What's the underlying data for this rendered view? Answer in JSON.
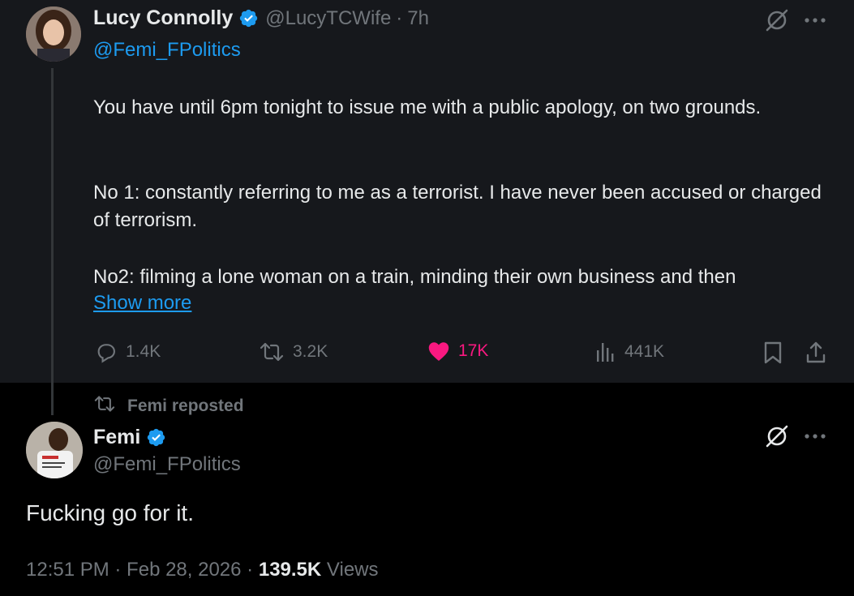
{
  "colors": {
    "background": "#000000",
    "quoted_background": "#16181c",
    "text_primary": "#e7e9ea",
    "text_secondary": "#71767b",
    "link": "#1d9bf0",
    "like": "#f91880",
    "verified": "#1d9bf0"
  },
  "quoted_tweet": {
    "author_name": "Lucy Connolly",
    "author_handle": "@LucyTCWife",
    "separator": "·",
    "time": "7h",
    "mention": "@Femi_FPolitics",
    "paragraphs": [
      "You have until 6pm tonight to issue me with a public apology, on two grounds.",
      "No 1: constantly referring to me as a terrorist. I have never been accused or charged of terrorism.",
      "No2: filming a lone woman on a train, minding their own business and then"
    ],
    "show_more": "Show more",
    "actions": {
      "replies": "1.4K",
      "reposts": "3.2K",
      "likes": "17K",
      "views": "441K"
    },
    "icons": {
      "grok": "grok-icon",
      "more": "more-icon",
      "reply": "reply-icon",
      "repost": "repost-icon",
      "like": "heart-icon",
      "views": "views-icon",
      "bookmark": "bookmark-icon",
      "share": "share-icon"
    }
  },
  "repost_banner": {
    "label": "Femi reposted"
  },
  "main_tweet": {
    "author_name": "Femi",
    "author_handle": "@Femi_FPolitics",
    "text": "Fucking go for it.",
    "timestamp": "12:51 PM · Feb 28, 2026",
    "separator": "·",
    "views_count": "139.5K",
    "views_label": "Views"
  }
}
